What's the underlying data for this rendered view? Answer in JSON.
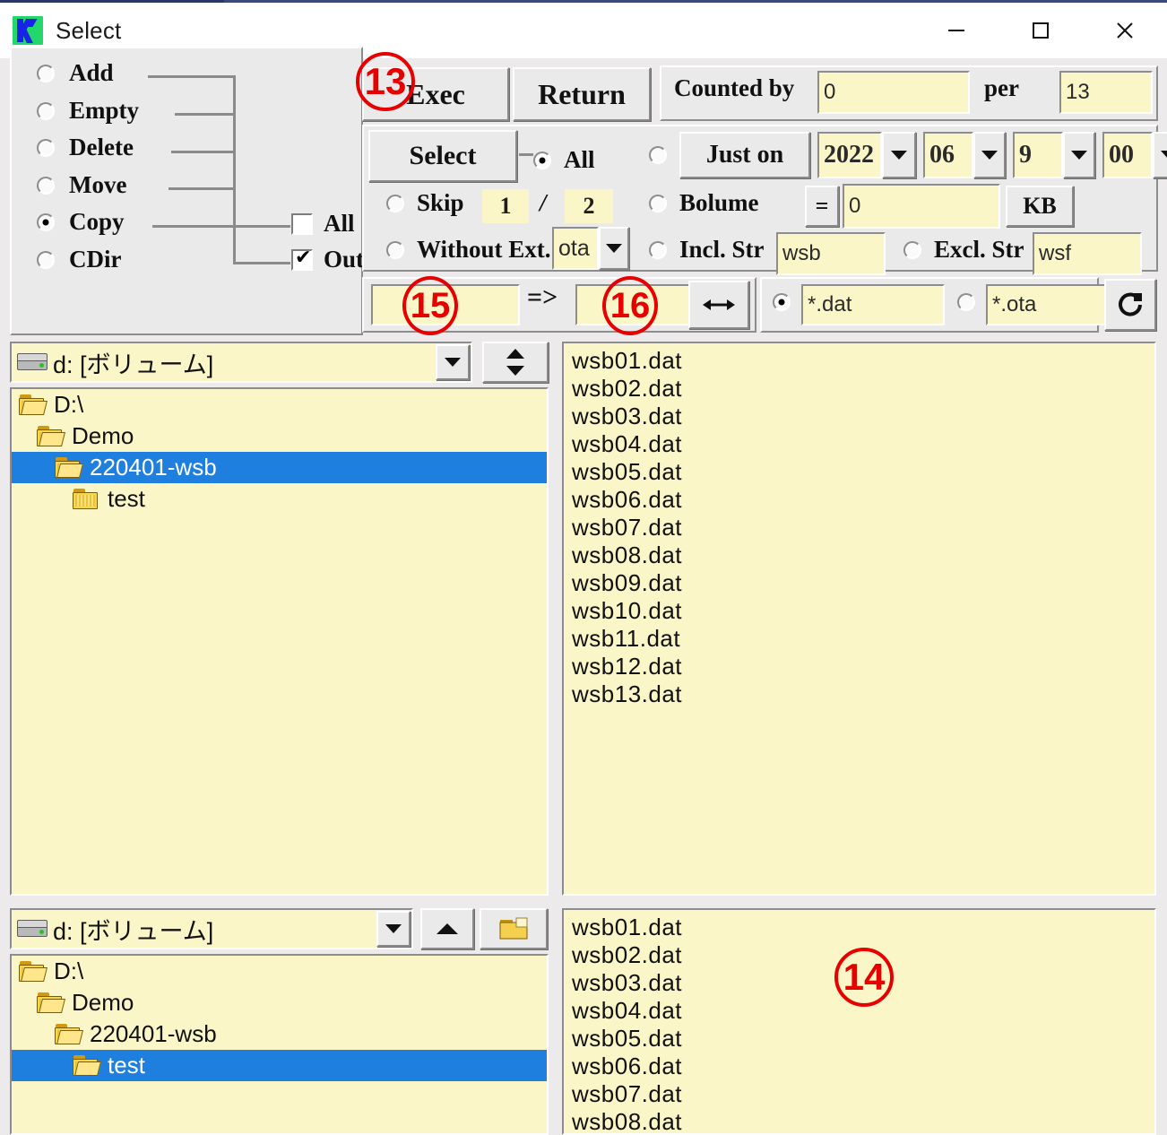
{
  "window": {
    "title": "Select",
    "icon": "app-logo-icon",
    "minimize": "minimize-icon",
    "maximize": "maximize-icon",
    "close": "close-icon"
  },
  "actions": {
    "items": [
      {
        "label": "Add",
        "selected": false
      },
      {
        "label": "Empty",
        "selected": false
      },
      {
        "label": "Delete",
        "selected": false
      },
      {
        "label": "Move",
        "selected": false
      },
      {
        "label": "Copy",
        "selected": true
      },
      {
        "label": "CDir",
        "selected": false
      }
    ],
    "checks": [
      {
        "label": "All",
        "checked": false
      },
      {
        "label": "Out",
        "checked": true
      }
    ]
  },
  "toolbar": {
    "exec_label": "Exec",
    "return_label": "Return",
    "counted_by_label": "Counted by",
    "counted_by_value": "0",
    "per_label": "per",
    "per_value": "13"
  },
  "select": {
    "select_label": "Select",
    "all_label": "All",
    "all_selected": true,
    "just_on_label": "Just on",
    "just_on_selected": false,
    "date": {
      "year": "2022",
      "month": "06",
      "day": "9",
      "hour": "00"
    },
    "skip_label": "Skip",
    "skip_selected": false,
    "skip_from": "1",
    "skip_sep": "/",
    "skip_to": "2",
    "bolume_label": "Bolume",
    "bolume_selected": false,
    "bolume_eq": "=",
    "bolume_value": "0",
    "bolume_unit": "KB",
    "without_ext_label": "Without Ext.",
    "without_ext_selected": false,
    "without_ext_value": "ota",
    "incl_str_label": "Incl. Str",
    "incl_str_selected": false,
    "incl_str_value": "wsb",
    "excl_str_label": "Excl. Str",
    "excl_str_selected": false,
    "excl_str_value": "wsf"
  },
  "rename": {
    "from_value": "",
    "arrow_label": "=>",
    "to_value": "",
    "swap_icon": "swap-horizontal-icon"
  },
  "filter": {
    "pattern_a": "*.dat",
    "pattern_a_selected": true,
    "pattern_b": "*.ota",
    "pattern_b_selected": false,
    "refresh_icon": "refresh-icon"
  },
  "source": {
    "drive_label": "d: [ボリューム]",
    "drive_icon": "drive-icon",
    "dropdown_icon": "chevron-down-icon",
    "spinner_icon": "up-down-spinner-icon",
    "tree": [
      {
        "label": "D:\\",
        "depth": 0,
        "selected": false,
        "open": true
      },
      {
        "label": "Demo",
        "depth": 1,
        "selected": false,
        "open": true
      },
      {
        "label": "220401-wsb",
        "depth": 2,
        "selected": true,
        "open": true
      },
      {
        "label": "test",
        "depth": 3,
        "selected": false,
        "open": false
      }
    ],
    "files": [
      "wsb01.dat",
      "wsb02.dat",
      "wsb03.dat",
      "wsb04.dat",
      "wsb05.dat",
      "wsb06.dat",
      "wsb07.dat",
      "wsb08.dat",
      "wsb09.dat",
      "wsb10.dat",
      "wsb11.dat",
      "wsb12.dat",
      "wsb13.dat"
    ]
  },
  "dest": {
    "drive_label": "d: [ボリューム]",
    "drive_icon": "drive-icon",
    "dropdown_icon": "chevron-down-icon",
    "up_icon": "up-arrow-icon",
    "new_folder_icon": "new-folder-icon",
    "tree": [
      {
        "label": "D:\\",
        "depth": 0,
        "selected": false,
        "open": true
      },
      {
        "label": "Demo",
        "depth": 1,
        "selected": false,
        "open": true
      },
      {
        "label": "220401-wsb",
        "depth": 2,
        "selected": false,
        "open": true
      },
      {
        "label": "test",
        "depth": 3,
        "selected": true,
        "open": true
      }
    ],
    "files": [
      "wsb01.dat",
      "wsb02.dat",
      "wsb03.dat",
      "wsb04.dat",
      "wsb05.dat",
      "wsb06.dat",
      "wsb07.dat",
      "wsb08.dat"
    ]
  },
  "markers": [
    {
      "label": "13"
    },
    {
      "label": "14"
    },
    {
      "label": "15"
    },
    {
      "label": "16"
    }
  ],
  "colors": {
    "field_bg": "#fbf6c8",
    "panel_bg": "#ebeaea",
    "selection": "#1e7fdf",
    "marker": "#e60000"
  }
}
